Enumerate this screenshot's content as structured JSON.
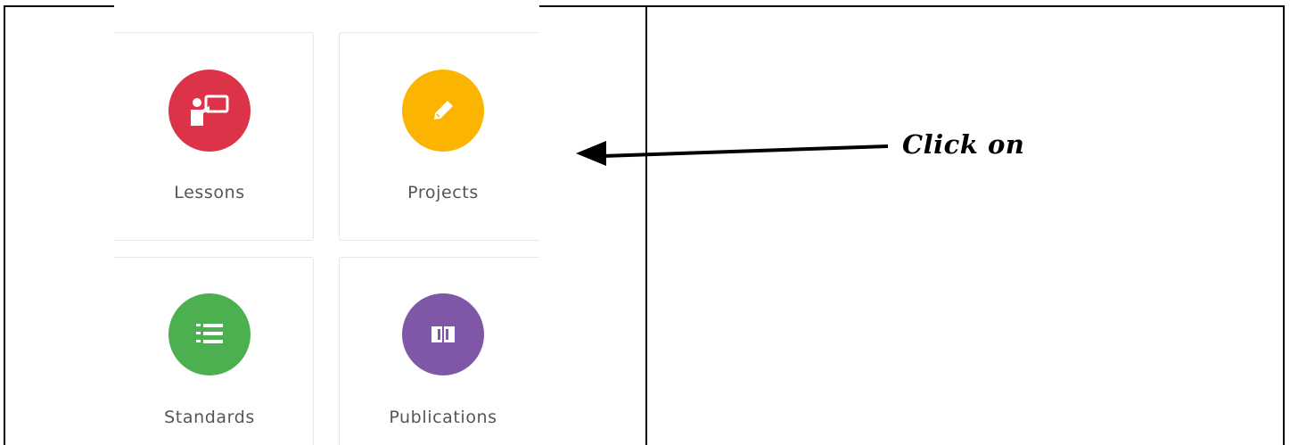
{
  "tiles": [
    {
      "label": "Lessons",
      "icon": "teacher-board-icon",
      "color": "#dc3348"
    },
    {
      "label": "Projects",
      "icon": "pencil-icon",
      "color": "#fbb400"
    },
    {
      "label": "Standards",
      "icon": "numbered-list-icon",
      "color": "#4caf50"
    },
    {
      "label": "Publications",
      "icon": "open-book-icon",
      "color": "#7e57a6"
    }
  ],
  "annotation": {
    "text": "Click on"
  }
}
